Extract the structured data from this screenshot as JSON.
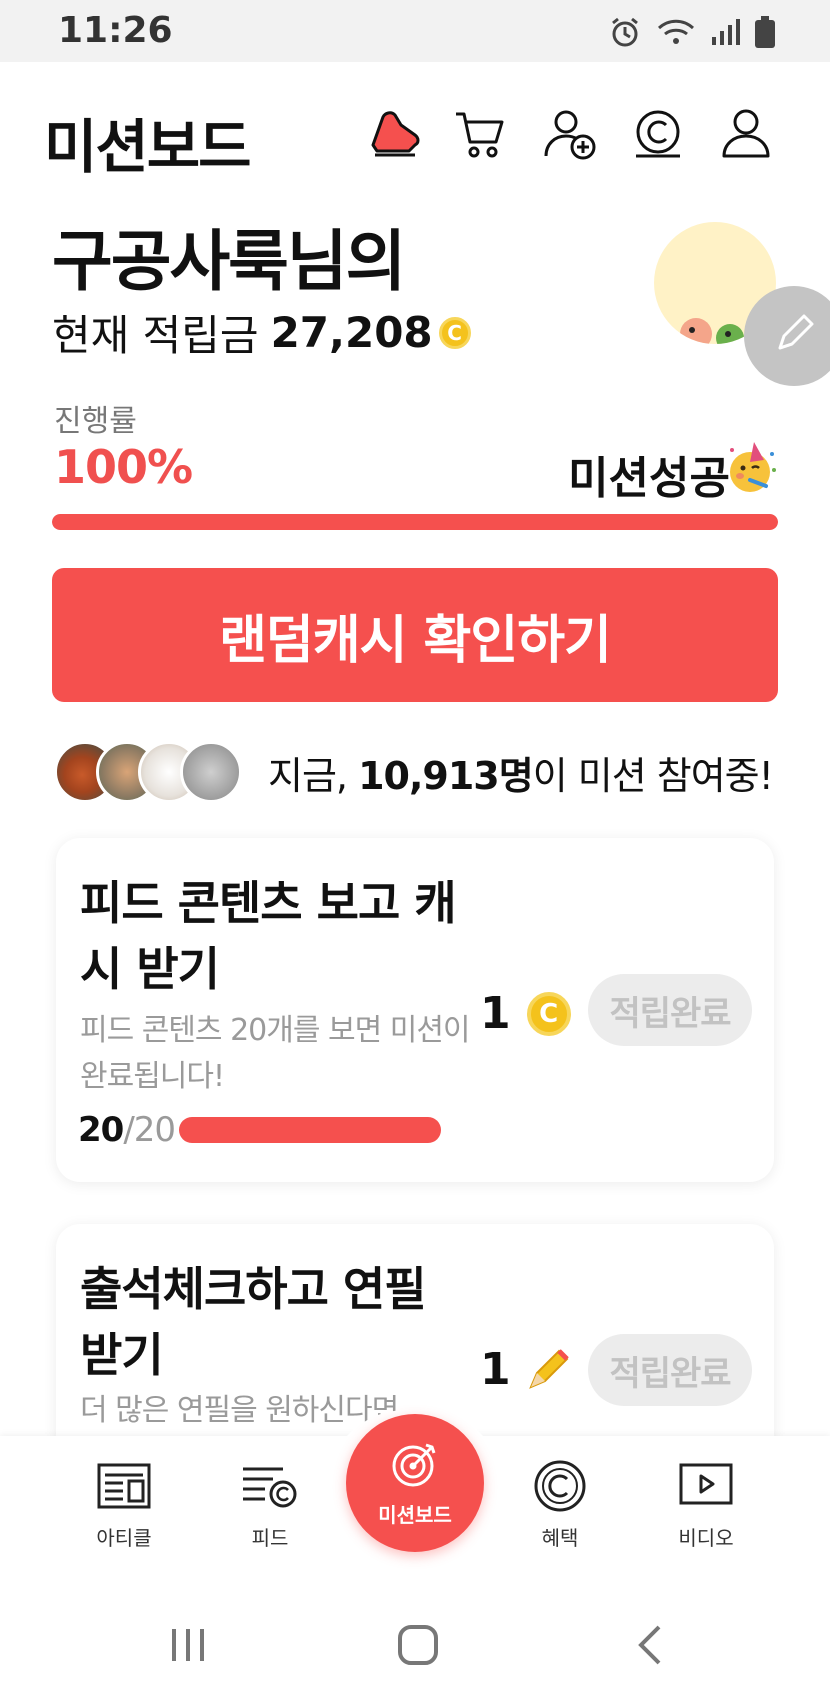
{
  "status_bar": {
    "time": "11:26",
    "icons": [
      "alarm-icon",
      "wifi-icon",
      "signal-icon",
      "battery-icon"
    ]
  },
  "header": {
    "title": "미션보드",
    "icons": [
      "sneaker-icon",
      "cart-icon",
      "add-friend-icon",
      "cash-coin-icon",
      "profile-icon"
    ]
  },
  "greeting": {
    "name_line": "구공사룩님의",
    "balance_label": "현재 적립금",
    "balance_value": "27,208",
    "coin_symbol": "C"
  },
  "progress": {
    "label": "진행률",
    "value": "100%",
    "fraction": 1.0,
    "status": "미션성공",
    "status_icon": "party-face-icon"
  },
  "cta": {
    "label": "랜덤캐시 확인하기"
  },
  "participants": {
    "prefix": "지금, ",
    "count": "10,913명",
    "suffix": "이 미션 참여중!"
  },
  "missions": [
    {
      "title": "피드 콘텐츠 보고 캐시 받기",
      "description": "피드 콘텐츠 20개를 보면 미션이 완료됩니다!",
      "progress_done": "20",
      "progress_total": "/20",
      "progress_fraction": 1.0,
      "reward_amount": "1",
      "reward_icon": "cash-coin-icon",
      "status": "적립완료"
    },
    {
      "title": "출석체크하고 연필 받기",
      "description": "더 많은 연필을 원하신다면",
      "reward_amount": "1",
      "reward_icon": "pencil-icon",
      "status": "적립완료"
    }
  ],
  "bottom_nav": {
    "items": [
      {
        "label": "아티클",
        "icon": "article-icon"
      },
      {
        "label": "피드",
        "icon": "feed-icon"
      },
      {
        "label": "미션보드",
        "icon": "target-icon"
      },
      {
        "label": "혜택",
        "icon": "benefit-icon"
      },
      {
        "label": "비디오",
        "icon": "video-icon"
      }
    ]
  },
  "colors": {
    "accent": "#f5504e",
    "coin": "#f4c21c",
    "muted": "#9a9a9a"
  }
}
